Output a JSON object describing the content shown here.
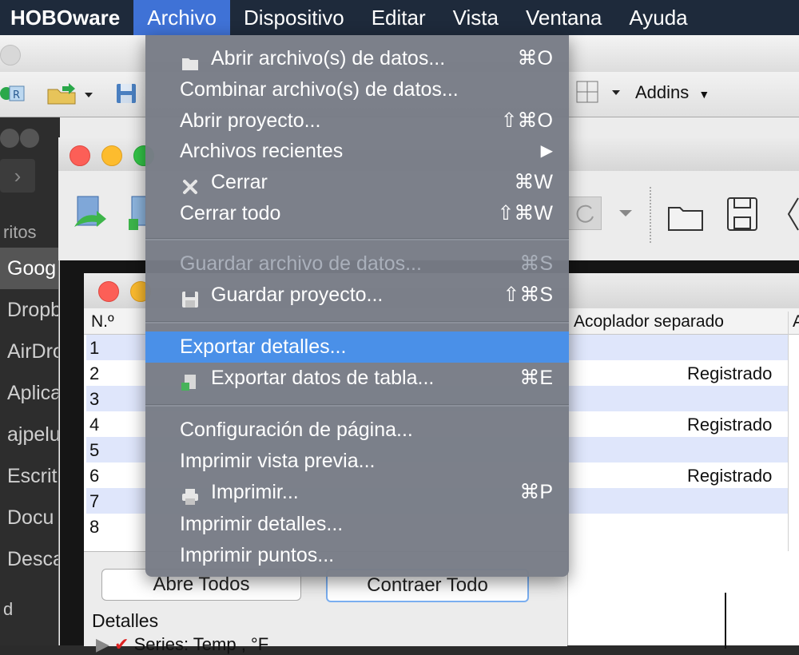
{
  "menubar": {
    "app_name": "HOBOware",
    "items": [
      "Archivo",
      "Dispositivo",
      "Editar",
      "Vista",
      "Ventana",
      "Ayuda"
    ]
  },
  "toolbar": {
    "addins_label": "Addins"
  },
  "sidebar": {
    "header": "ritos",
    "items": [
      "Goog",
      "Dropb",
      "AirDro",
      "Aplica",
      "ajpelu",
      "Escrit",
      "Docu",
      "Desca"
    ],
    "footer": "d"
  },
  "table": {
    "col_number": "N.º",
    "col_coupler": "Acoplador separado",
    "col_next": "A",
    "rows": [
      "1",
      "2",
      "3",
      "4",
      "5",
      "6",
      "7",
      "8"
    ],
    "status_registered": "Registrado"
  },
  "details_pane": {
    "open_all": "Abre Todos",
    "collapse_all": "Contraer Todo",
    "details_label": "Detalles",
    "series_label": "Series: Temp , °F"
  },
  "archivo_menu": {
    "open_data": "Abrir archivo(s) de datos...",
    "open_data_sc": "⌘O",
    "combine_data": "Combinar archivo(s) de datos...",
    "open_project": "Abrir proyecto...",
    "open_project_sc": "⇧⌘O",
    "recent": "Archivos recientes",
    "recent_arrow": "▶",
    "close": "Cerrar",
    "close_sc": "⌘W",
    "close_all": "Cerrar todo",
    "close_all_sc": "⇧⌘W",
    "save_data": "Guardar archivo de datos...",
    "save_data_sc": "⌘S",
    "save_project": "Guardar proyecto...",
    "save_project_sc": "⇧⌘S",
    "export_details": "Exportar detalles...",
    "export_table": "Exportar datos de tabla...",
    "export_table_sc": "⌘E",
    "page_setup": "Configuración de página...",
    "print_preview": "Imprimir vista previa...",
    "print": "Imprimir...",
    "print_sc": "⌘P",
    "print_details": "Imprimir detalles...",
    "print_points": "Imprimir puntos..."
  },
  "colors": {
    "menubar_bg": "#1e2a3b",
    "menu_active": "#3f72d6",
    "menu_highlight": "#4a90e8",
    "table_alt_row": "#dfe6fb"
  }
}
